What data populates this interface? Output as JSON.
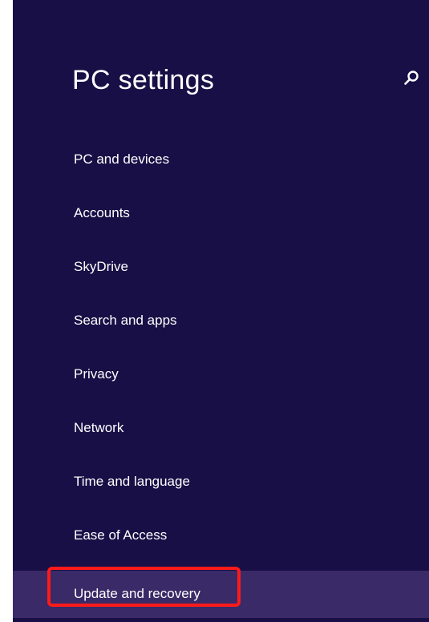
{
  "header": {
    "title": "PC settings",
    "search_icon": "search-icon"
  },
  "nav": {
    "items": [
      {
        "label": "PC and devices"
      },
      {
        "label": "Accounts"
      },
      {
        "label": "SkyDrive"
      },
      {
        "label": "Search and apps"
      },
      {
        "label": "Privacy"
      },
      {
        "label": "Network"
      },
      {
        "label": "Time and language"
      },
      {
        "label": "Ease of Access"
      },
      {
        "label": "Update and recovery",
        "selected": true
      }
    ]
  },
  "colors": {
    "background": "#180f46",
    "selected_item": "#3a2a67",
    "text": "#ffffff",
    "highlight_annotation": "#ff1a1a"
  }
}
